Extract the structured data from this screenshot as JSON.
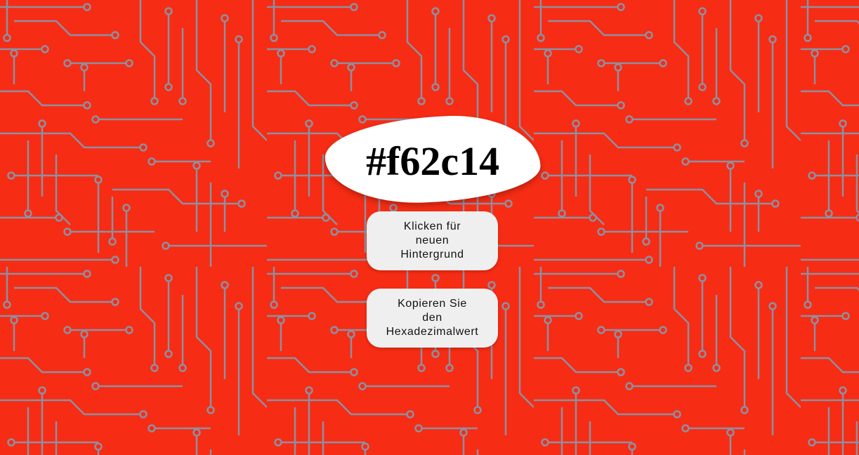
{
  "colors": {
    "background": "#f62c14",
    "trace": "#8f8fa0",
    "card": "#ffffff",
    "button": "#efefef"
  },
  "hex_display": {
    "value": "#f62c14"
  },
  "buttons": {
    "new_background": "Klicken für\nneuen\nHintergrund",
    "copy_hex": "Kopieren Sie\nden\nHexadezimalwert"
  },
  "background": {
    "pattern": "circuit-board"
  }
}
